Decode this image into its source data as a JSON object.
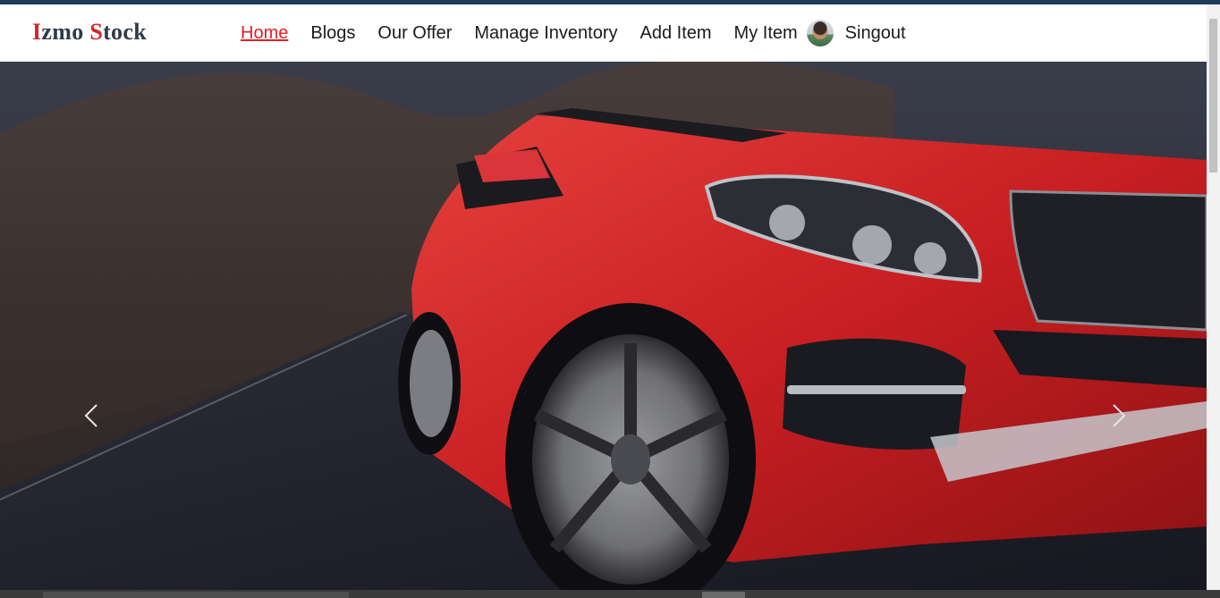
{
  "brand": {
    "first_initial": "I",
    "first_rest": "zmo ",
    "second_initial": "S",
    "second_rest": "tock"
  },
  "nav": {
    "home": "Home",
    "blogs": "Blogs",
    "our_offer": "Our Offer",
    "manage_inventory": "Manage Inventory",
    "add_item": "Add Item",
    "my_item": "My Item",
    "signout": "Singout"
  },
  "colors": {
    "accent": "#e01f26",
    "brand_dark": "#2f3b49",
    "top_strip": "#1f3a5b",
    "car_red": "#d3262b"
  },
  "icons": {
    "prev": "chevron-left-icon",
    "next": "chevron-right-icon",
    "user": "avatar"
  }
}
